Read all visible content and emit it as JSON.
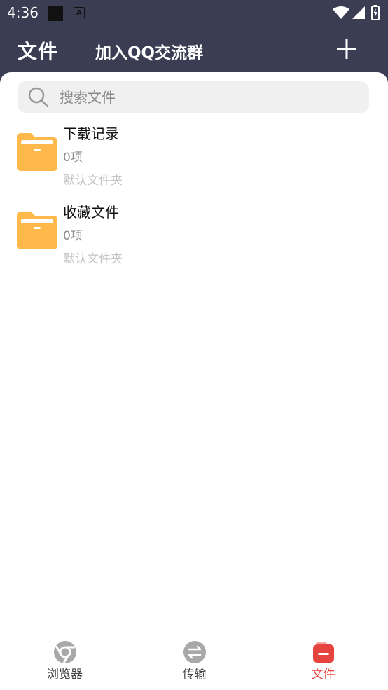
{
  "status_bar": {
    "time": "4:36"
  },
  "header": {
    "title": "文件",
    "qq_link": "加入QQ交流群"
  },
  "search": {
    "placeholder": "搜索文件"
  },
  "folders": [
    {
      "name": "下载记录",
      "count": "0项",
      "description": "默认文件夹"
    },
    {
      "name": "收藏文件",
      "count": "0项",
      "description": "默认文件夹"
    }
  ],
  "tabs": [
    {
      "label": "浏览器",
      "icon": "browser-icon",
      "active": false
    },
    {
      "label": "传输",
      "icon": "transfer-icon",
      "active": false
    },
    {
      "label": "文件",
      "icon": "files-icon",
      "active": true
    }
  ],
  "colors": {
    "header_bg": "#3b3d53",
    "folder": "#ffb84a",
    "active_tab": "#e5433d",
    "inactive_icon": "#a8a8a8"
  }
}
